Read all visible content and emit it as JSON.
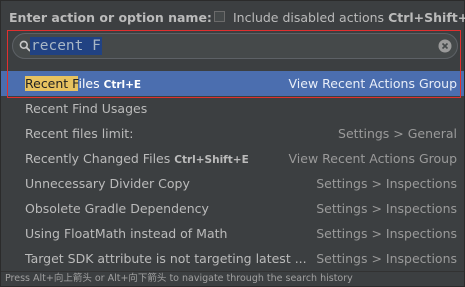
{
  "header": {
    "title": "Enter action or option name:",
    "include_label": "Include disabled actions",
    "include_shortcut": "Ctrl+Shift+A",
    "include_checked": false
  },
  "search": {
    "value": "recent F"
  },
  "results": [
    {
      "name_highlight": "Recent F",
      "name_rest": "iles",
      "shortcut": "Ctrl+E",
      "group": "View Recent Actions Group",
      "selected": true
    },
    {
      "name_highlight": "",
      "name_rest": "Recent Find Usages",
      "shortcut": "",
      "group": "",
      "selected": false
    },
    {
      "name_highlight": "",
      "name_rest": "Recent files limit:",
      "shortcut": "",
      "group": "Settings > General",
      "selected": false
    },
    {
      "name_highlight": "",
      "name_rest": "Recently Changed Files",
      "shortcut": "Ctrl+Shift+E",
      "group": "View Recent Actions Group",
      "selected": false
    },
    {
      "name_highlight": "",
      "name_rest": "Unnecessary Divider Copy",
      "shortcut": "",
      "group": "Settings > Inspections",
      "selected": false
    },
    {
      "name_highlight": "",
      "name_rest": "Obsolete Gradle Dependency",
      "shortcut": "",
      "group": "Settings > Inspections",
      "selected": false
    },
    {
      "name_highlight": "",
      "name_rest": "Using FloatMath instead of Math",
      "shortcut": "",
      "group": "Settings > Inspections",
      "selected": false
    },
    {
      "name_highlight": "",
      "name_rest": "Target SDK attribute is not targeting latest ...",
      "shortcut": "",
      "group": "Settings > Inspections",
      "selected": false
    }
  ],
  "footer": {
    "hint": "Press Alt+向上箭头 or Alt+向下箭头 to navigate through the search history"
  },
  "colors": {
    "background": "#3c3f41",
    "selection": "#4b6eaf",
    "highlight": "#e7c260",
    "annotation_outline": "#e0302f"
  }
}
